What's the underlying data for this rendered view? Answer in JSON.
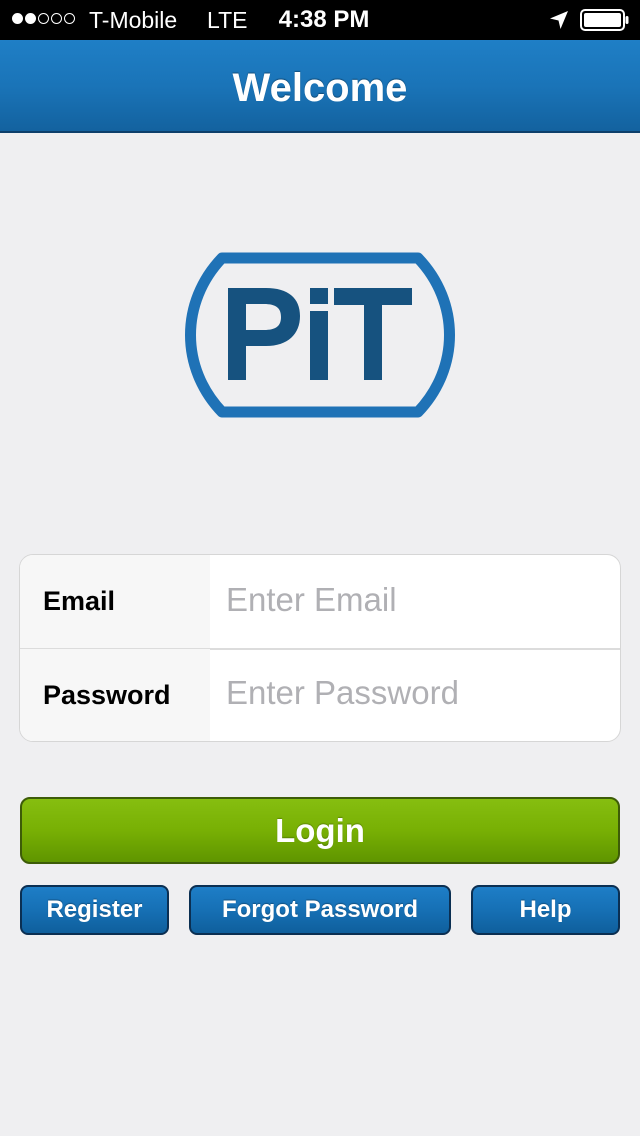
{
  "status_bar": {
    "signal_strength": 2,
    "signal_max": 5,
    "carrier": "T-Mobile",
    "network": "LTE",
    "time": "4:38 PM",
    "battery_level": 1.0,
    "icons": [
      "location-arrow-icon",
      "battery-icon"
    ]
  },
  "nav": {
    "title": "Welcome",
    "color": "#1a74b8"
  },
  "logo": {
    "text": "PiT",
    "color": "#1f72b6",
    "text_color": "#16527f"
  },
  "form": {
    "email_label": "Email",
    "email_placeholder": "Enter Email",
    "email_value": "",
    "password_label": "Password",
    "password_placeholder": "Enter Password",
    "password_value": ""
  },
  "buttons": {
    "login": "Login",
    "register": "Register",
    "forgot_password": "Forgot Password",
    "help": "Help"
  },
  "colors": {
    "login_green": "#78b004",
    "button_blue": "#1670b5",
    "background": "#efeff1"
  }
}
